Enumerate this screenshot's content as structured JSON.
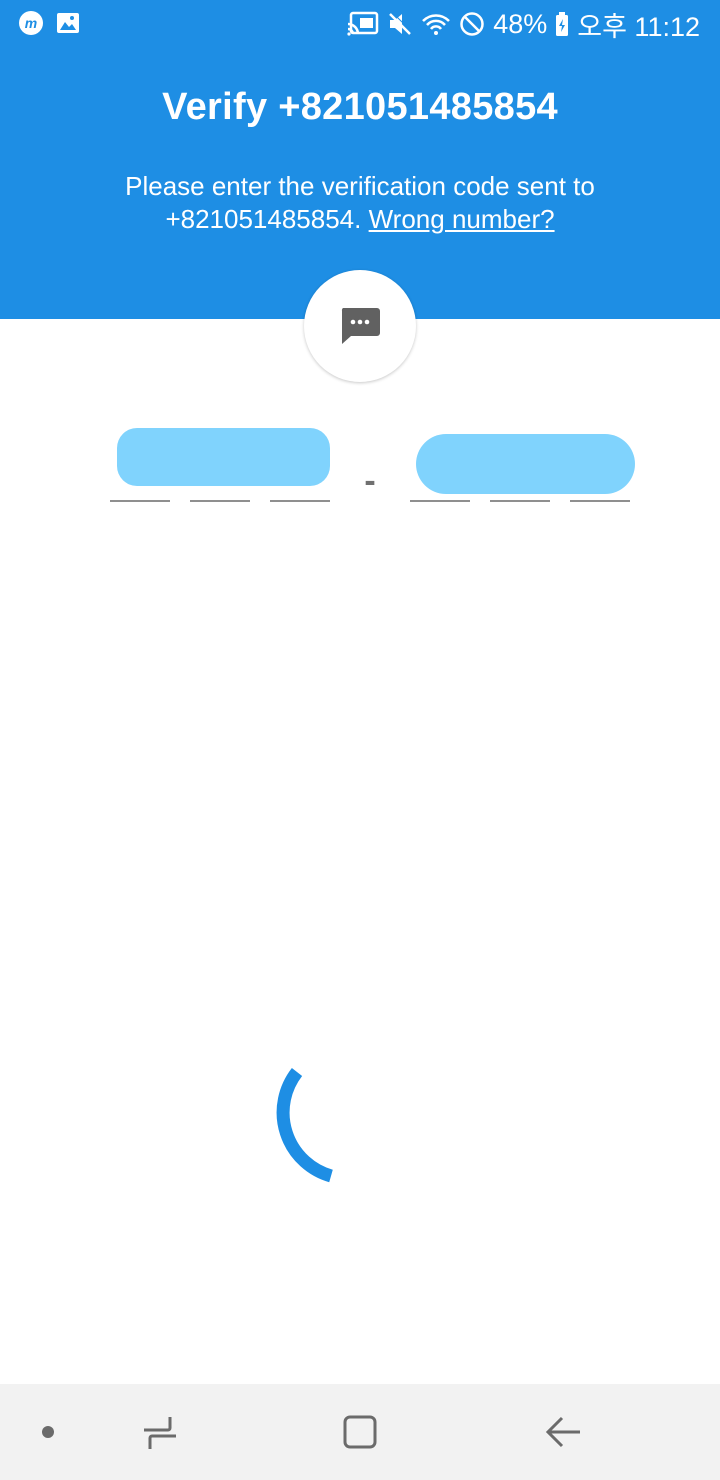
{
  "status_bar": {
    "battery_percent": "48%",
    "time": "오후 11:12",
    "icons": [
      "messenger-icon",
      "gallery-icon",
      "cast-icon",
      "mute-icon",
      "wifi-icon",
      "blocked-icon",
      "battery-icon"
    ]
  },
  "header": {
    "title": "Verify +821051485854",
    "subtitle_text": "Please enter the verification code sent to +821051485854.",
    "wrong_number_link": "Wrong number?"
  },
  "code": {
    "separator": "-",
    "digits": [
      "",
      "",
      "",
      "",
      "",
      ""
    ]
  },
  "colors": {
    "primary": "#1e8ee4",
    "redaction": "#80d3fd",
    "nav_background": "#f2f2f2"
  },
  "nav_bar": {
    "icons": [
      "dot-icon",
      "recent-apps-icon",
      "home-icon",
      "back-icon"
    ]
  }
}
